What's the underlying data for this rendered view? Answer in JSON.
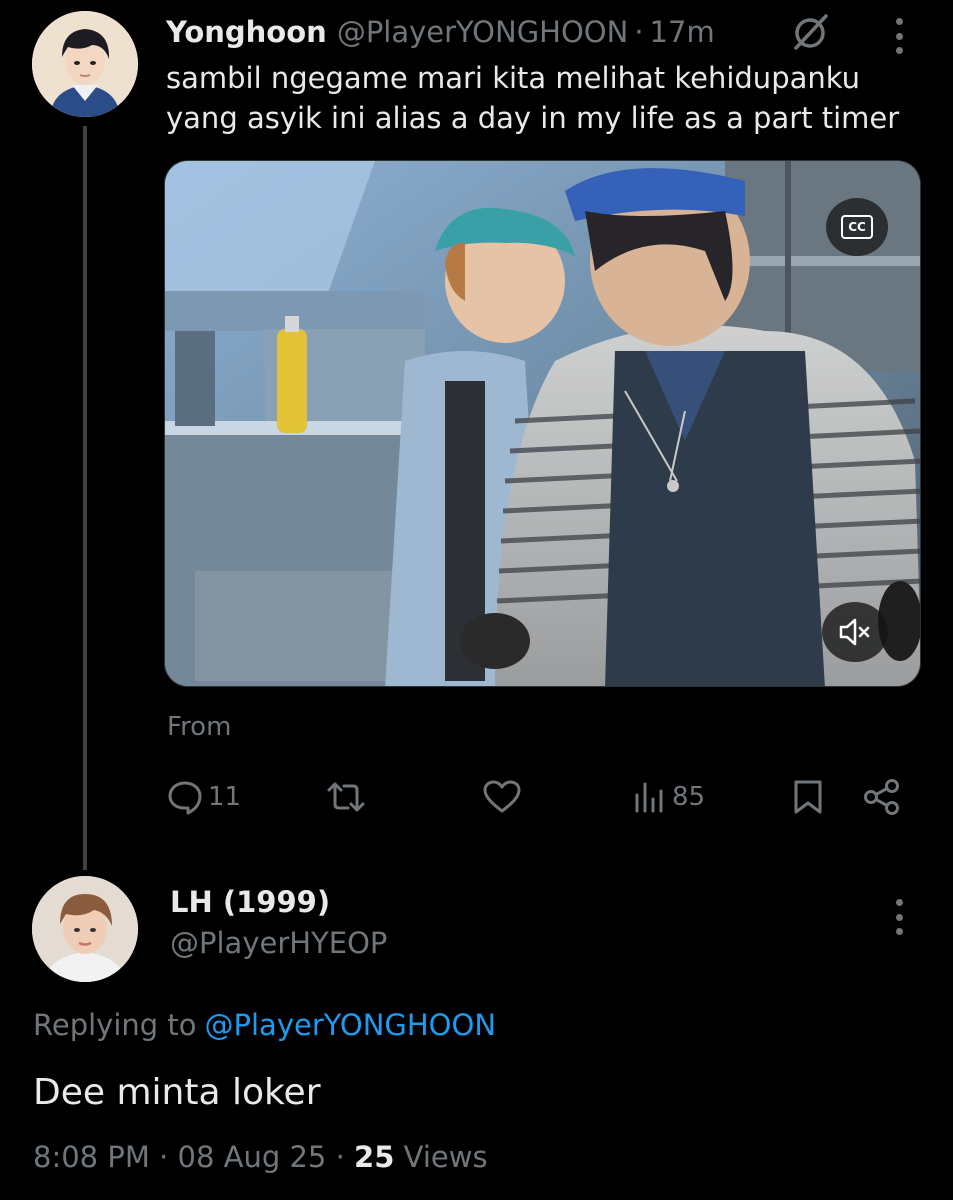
{
  "parent_tweet": {
    "author_name": "Yonghoon",
    "handle": "@PlayerYONGHOON",
    "separator": "·",
    "time": "17m",
    "text_line1": "sambil ngegame mari kita melihat kehidupanku",
    "text_line2": "yang asyik ini alias a day in my life as a part timer",
    "media": {
      "description_icon": "video-thumbnail",
      "cc_label": "CC"
    },
    "from_label": "From",
    "actions": {
      "reply_count": "11",
      "views_count": "85"
    }
  },
  "reply_tweet": {
    "author_name": "LH (1999)",
    "handle": "@PlayerHYEOP",
    "replying_prefix": "Replying to",
    "replying_handle": "@PlayerYONGHOON",
    "text": "Dee minta loker",
    "time": "8:08 PM",
    "separator": "·",
    "date": "08 Aug 25",
    "views_count": "25",
    "views_label": "Views"
  },
  "colors": {
    "background": "#000000",
    "text_primary": "#e7e9ea",
    "text_secondary": "#71767b",
    "accent": "#1d9bf0"
  }
}
